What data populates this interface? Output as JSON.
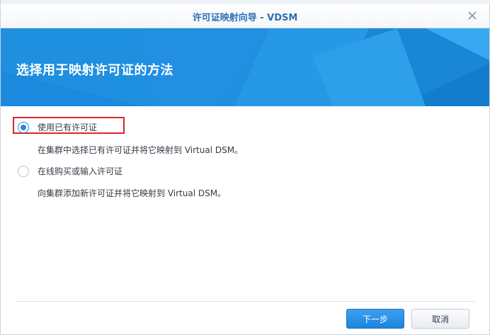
{
  "window": {
    "title": "许可证映射向导 - VDSM"
  },
  "banner": {
    "heading": "选择用于映射许可证的方法"
  },
  "options": [
    {
      "label": "使用已有许可证",
      "description": "在集群中选择已有许可证并将它映射到 Virtual DSM。",
      "selected": true
    },
    {
      "label": "在线购买或输入许可证",
      "description": "向集群添加新许可证并将它映射到 Virtual DSM。",
      "selected": false
    }
  ],
  "footer": {
    "next_label": "下一步",
    "cancel_label": "取消"
  },
  "colors": {
    "accent": "#1f8fe0",
    "title_text": "#2b6fb4",
    "highlight": "#d9262b"
  }
}
